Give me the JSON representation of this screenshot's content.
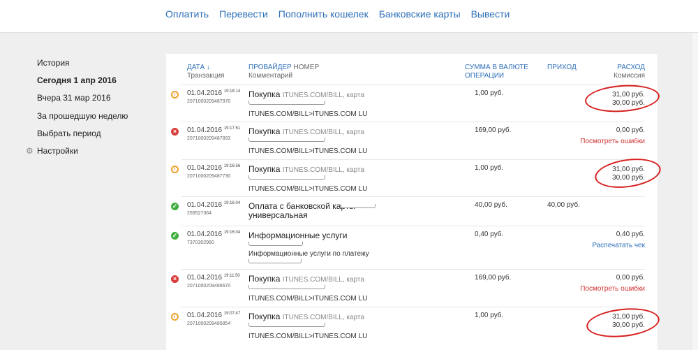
{
  "topnav": [
    "Оплатить",
    "Перевести",
    "Пополнить кошелек",
    "Банковские карты",
    "Вывести"
  ],
  "sidebar": {
    "items": [
      "История",
      "Сегодня 1 апр 2016",
      "Вчера 31 мар 2016",
      "За прошедшую неделю",
      "Выбрать период"
    ],
    "settings": "Настройки"
  },
  "table": {
    "headers": {
      "date": "ДАТА ↓",
      "date_sub": "Транзакция",
      "provider": "ПРОВАЙДЕР",
      "number": "НОМЕР",
      "provider_sub": "Комментарий",
      "sum_line1": "СУММА В ВАЛЮТЕ",
      "sum_line2": "ОПЕРАЦИИ",
      "income": "ПРИХОД",
      "expense": "РАСХОД",
      "expense_sub": "Комиссия"
    },
    "rows": [
      {
        "status": "pending",
        "date": "01.04.2016",
        "time": "19:18:14",
        "txid": "2071000209487970",
        "provider": "Покупка",
        "number": "ITUNES.COM/BILL, карта",
        "comment": "ITUNES.COM/BILL>ITUNES.COM LU",
        "sum": "1,00 руб.",
        "income": "",
        "expense": "31,00 руб.",
        "commission": "30,00 руб.",
        "link": ""
      },
      {
        "status": "error",
        "date": "01.04.2016",
        "time": "19:17:51",
        "txid": "2071000209487893",
        "provider": "Покупка",
        "number": "ITUNES.COM/BILL, карта",
        "comment": "ITUNES.COM/BILL>ITUNES.COM LU",
        "sum": "169,00 руб.",
        "income": "",
        "expense": "0,00 руб.",
        "commission": "",
        "link": "Посмотреть ошибки"
      },
      {
        "status": "pending",
        "date": "01.04.2016",
        "time": "19:16:56",
        "txid": "2071000209487730",
        "provider": "Покупка",
        "number": "ITUNES.COM/BILL, карта",
        "comment": "ITUNES.COM/BILL>ITUNES.COM LU",
        "sum": "1,00 руб.",
        "income": "",
        "expense": "31,00 руб.",
        "commission": "30,00 руб.",
        "link": ""
      },
      {
        "status": "ok",
        "date": "01.04.2016",
        "time": "19:16:04",
        "txid": "259527364",
        "provider": "Оплата с банковской карты",
        "provider_line2": "универсальная",
        "number": "",
        "comment": "",
        "sum": "40,00 руб.",
        "income": "40,00 руб.",
        "expense": "",
        "commission": "",
        "link": ""
      },
      {
        "status": "ok",
        "date": "01.04.2016",
        "time": "19:16:04",
        "txid": "7370302960",
        "provider": "Информационные услуги",
        "number": "",
        "comment": "Информационные услуги по платежу",
        "sum": "0,40 руб.",
        "income": "",
        "expense": "0,40 руб.",
        "commission": "",
        "link": "Распечатать чек"
      },
      {
        "status": "error",
        "date": "01.04.2016",
        "time": "19:11:50",
        "txid": "2071000209486670",
        "provider": "Покупка",
        "number": "ITUNES.COM/BILL, карта",
        "comment": "ITUNES.COM/BILL>ITUNES.COM LU",
        "sum": "169,00 руб.",
        "income": "",
        "expense": "0,00 руб.",
        "commission": "",
        "link": "Посмотреть ошибки"
      },
      {
        "status": "pending",
        "date": "01.04.2016",
        "time": "19:07:47",
        "txid": "2071000209485854",
        "provider": "Покупка",
        "number": "ITUNES.COM/BILL, карта",
        "comment": "ITUNES.COM/BILL>ITUNES.COM LU",
        "sum": "1,00 руб.",
        "income": "",
        "expense": "31,00 руб.",
        "commission": "30,00 руб.",
        "link": ""
      }
    ]
  },
  "colors": {
    "accent": "#2e6fb8",
    "error": "#d03030",
    "highlight": "#d61f1f",
    "ok": "#3fae3f",
    "pending": "#f0a030"
  }
}
